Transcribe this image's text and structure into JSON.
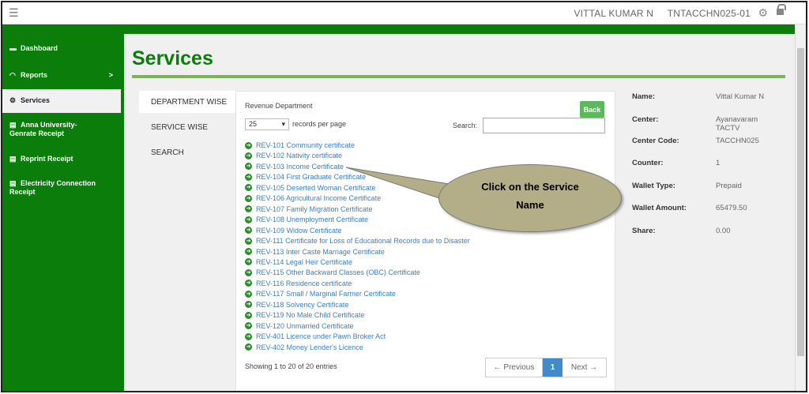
{
  "topbar": {
    "menu_icon": "hamburger-icon",
    "user_name": "VITTAL KUMAR N",
    "user_id": "TNTACCHN025-01",
    "settings_icon": "gear-icon",
    "lock_icon": "lock-icon"
  },
  "sidebar": {
    "items": [
      {
        "label": "Dashboard",
        "icon": "dashboard-icon"
      },
      {
        "label": "Reports",
        "icon": "gauge-icon",
        "chevron": ">"
      },
      {
        "label": "Services",
        "icon": "gear-icon"
      },
      {
        "label": "Anna University-",
        "label2": "Genrate Receipt",
        "icon": "receipt-icon"
      },
      {
        "label": "Reprint Receipt",
        "icon": "receipt-icon"
      },
      {
        "label": "Electricity Connection",
        "label2": "Receipt",
        "icon": "receipt-icon"
      }
    ]
  },
  "page": {
    "title": "Services"
  },
  "tabs": [
    "DEPARTMENT WISE",
    "SERVICE WISE",
    "SEARCH"
  ],
  "card": {
    "department": "Revenue Department",
    "back_label": "Back",
    "records_value": "25",
    "records_label": "records per page",
    "search_label": "Search:",
    "search_value": "",
    "services": [
      "REV-101 Community certificate",
      "REV-102 Nativity certificate",
      "REV-103 Income Certificate",
      "REV-104 First Graduate Certificate",
      "REV-105 Deserted Woman Certificate",
      "REV-106 Agricultural Income Certificate",
      "REV-107 Family Migration Certificate",
      "REV-108 Unemployment Certificate",
      "REV-109 Widow Certificate",
      "REV-111 Certificate for Loss of Educational Records due to Disaster",
      "REV-113 Inter Caste Marriage Certificate",
      "REV-114 Legal Heir Certificate",
      "REV-115 Other Backward Classes (OBC) Certificate",
      "REV-116 Residence certificate",
      "REV-117 Small / Marginal Farmer Certificate",
      "REV-118 Solvency Certificate",
      "REV-119 No Male Child Certificate",
      "REV-120 Unmarried Certificate",
      "REV-401 Licence under Pawn Broker Act",
      "REV-402 Money Lender's Licence"
    ],
    "entries_info": "Showing 1 to 20 of 20 entries",
    "pager": {
      "prev": "← Previous",
      "current": "1",
      "next": "Next →"
    }
  },
  "details": [
    {
      "key": "Name:",
      "value": "Vittal Kumar N"
    },
    {
      "key": "Center:",
      "value": "Ayanavaram",
      "value2": "TACTV"
    },
    {
      "key": "Center Code:",
      "value": "TACCHN025"
    },
    {
      "key": "Counter:",
      "value": "1"
    },
    {
      "key": "Wallet Type:",
      "value": "Prepaid"
    },
    {
      "key": "Wallet Amount:",
      "value": "65479.50"
    },
    {
      "key": "Share:",
      "value": "0.00"
    }
  ],
  "callout": {
    "line1": "Click on the Service",
    "line2": "Name",
    "color": "#b3ae87"
  }
}
